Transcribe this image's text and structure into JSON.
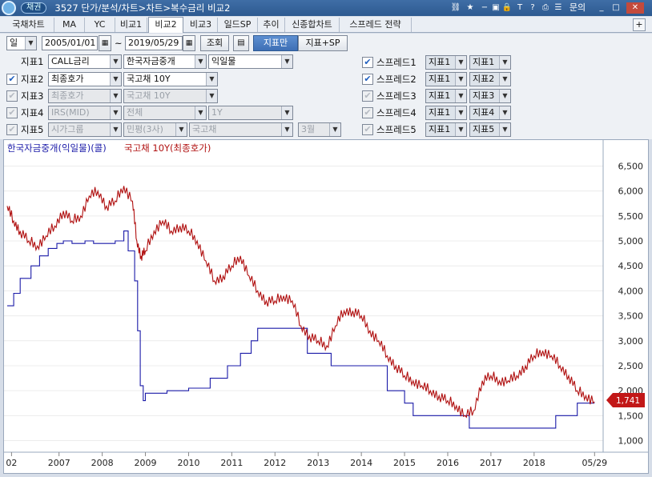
{
  "titlebar": {
    "badge": "채권",
    "title": "3527 단가/분석/차트>차트>복수금리 비교2",
    "menu_label": "문의"
  },
  "tabs": [
    "국채차트",
    "MA",
    "YC",
    "비교1",
    "비교2",
    "비교3",
    "일드SP",
    "추이",
    "신종합차트",
    "스프레드 전략"
  ],
  "active_tab": 4,
  "tab_plus": "+",
  "toolbar": {
    "period": "일",
    "start_date": "2005/01/01",
    "tilde": "~",
    "end_date": "2019/05/29",
    "query_label": "조회",
    "indicator_only_label": "지표만",
    "indicator_sp_label": "지표+SP"
  },
  "indicators": [
    {
      "label": "지표1",
      "checkbox": false,
      "enabled": true,
      "field1": "CALL금리",
      "field2": "한국자금중개",
      "field3": "익일물",
      "field4": ""
    },
    {
      "label": "지표2",
      "checkbox": true,
      "enabled": true,
      "field1": "최종호가",
      "field2": "국고채 10Y",
      "field3": "",
      "field4": ""
    },
    {
      "label": "지표3",
      "checkbox": true,
      "enabled": false,
      "field1": "최종호가",
      "field2": "국고채 10Y",
      "field3": "",
      "field4": ""
    },
    {
      "label": "지표4",
      "checkbox": true,
      "enabled": false,
      "field1": "IRS(MID)",
      "field2": "전체",
      "field3": "1Y",
      "field4": ""
    },
    {
      "label": "지표5",
      "checkbox": true,
      "enabled": false,
      "field1": "시가그룹",
      "field2": "민평(3사)",
      "field3": "국고채",
      "field4": "3월"
    }
  ],
  "spreads": [
    {
      "label": "스프레드1",
      "checked": true,
      "a": "지표1",
      "b": "지표1"
    },
    {
      "label": "스프레드2",
      "checked": true,
      "a": "지표1",
      "b": "지표2"
    },
    {
      "label": "스프레드3",
      "checked": false,
      "a": "지표1",
      "b": "지표3"
    },
    {
      "label": "스프레드4",
      "checked": false,
      "a": "지표1",
      "b": "지표4"
    },
    {
      "label": "스프레드5",
      "checked": false,
      "a": "지표1",
      "b": "지표5"
    }
  ],
  "chart_data": {
    "type": "line",
    "legend": [
      {
        "name": "한국자금중개(익일물)(콜)",
        "color": "#1a1aa8"
      },
      {
        "name": "국고채 10Y(최종호가)",
        "color": "#b01010"
      }
    ],
    "ylim": [
      800,
      6700
    ],
    "yticks": [
      "6,500",
      "6,000",
      "5,500",
      "5,000",
      "4,500",
      "4,000",
      "3,500",
      "3,000",
      "2,500",
      "2,000",
      "1,500",
      "1,000"
    ],
    "ytick_values": [
      6500,
      6000,
      5500,
      5000,
      4500,
      4000,
      3500,
      3000,
      2500,
      2000,
      1500,
      1000
    ],
    "xticks": [
      "02",
      "2007",
      "2008",
      "2009",
      "2010",
      "2011",
      "2012",
      "2013",
      "2014",
      "2015",
      "2016",
      "2017",
      "2018",
      "05/29"
    ],
    "xtick_years": [
      2005.9,
      2007,
      2008,
      2009,
      2010,
      2011,
      2012,
      2013,
      2014,
      2015,
      2016,
      2017,
      2018,
      2019.4
    ],
    "xlim": [
      2005.8,
      2019.45
    ],
    "last_value_label": "1,741",
    "series": [
      {
        "name": "한국자금중개(익일물)(콜)",
        "color": "#1a1aa8",
        "step": true,
        "x": [
          2005.8,
          2005.95,
          2006.1,
          2006.35,
          2006.55,
          2006.75,
          2006.95,
          2007.1,
          2007.3,
          2007.6,
          2007.8,
          2008.0,
          2008.3,
          2008.5,
          2008.6,
          2008.75,
          2008.82,
          2008.88,
          2008.95,
          2009.0,
          2009.5,
          2010.0,
          2010.5,
          2010.9,
          2011.2,
          2011.45,
          2011.6,
          2012.5,
          2012.75,
          2013.3,
          2013.8,
          2014.6,
          2015.0,
          2015.2,
          2015.55,
          2016.25,
          2016.5,
          2016.9,
          2017.0,
          2017.3,
          2017.9,
          2018.5,
          2018.9,
          2019.0,
          2019.4
        ],
        "y": [
          3700,
          3950,
          4250,
          4500,
          4700,
          4850,
          4950,
          5000,
          4950,
          5000,
          4950,
          4950,
          5000,
          5200,
          4800,
          4200,
          3200,
          2100,
          1800,
          1950,
          2000,
          2050,
          2250,
          2500,
          2750,
          3000,
          3250,
          3250,
          2750,
          2500,
          2500,
          2000,
          1750,
          1500,
          1500,
          1500,
          1250,
          1250,
          1250,
          1250,
          1250,
          1500,
          1500,
          1750,
          1750
        ]
      },
      {
        "name": "국고채 10Y(최종호가)",
        "color": "#b01010",
        "step": false,
        "x": [
          2005.8,
          2005.95,
          2006.1,
          2006.3,
          2006.5,
          2006.7,
          2006.9,
          2007.1,
          2007.3,
          2007.5,
          2007.7,
          2007.9,
          2008.1,
          2008.3,
          2008.5,
          2008.7,
          2008.8,
          2008.9,
          2009.0,
          2009.2,
          2009.4,
          2009.6,
          2009.8,
          2010.0,
          2010.2,
          2010.4,
          2010.6,
          2010.8,
          2011.0,
          2011.2,
          2011.4,
          2011.6,
          2011.8,
          2012.0,
          2012.2,
          2012.4,
          2012.6,
          2012.8,
          2013.0,
          2013.2,
          2013.4,
          2013.6,
          2013.8,
          2014.0,
          2014.2,
          2014.4,
          2014.6,
          2014.8,
          2015.0,
          2015.2,
          2015.4,
          2015.6,
          2015.8,
          2016.0,
          2016.2,
          2016.4,
          2016.6,
          2016.8,
          2017.0,
          2017.2,
          2017.4,
          2017.6,
          2017.8,
          2018.0,
          2018.2,
          2018.4,
          2018.6,
          2018.8,
          2019.0,
          2019.2,
          2019.4
        ],
        "y": [
          5700,
          5400,
          5200,
          5000,
          4900,
          5100,
          5300,
          5600,
          5400,
          5500,
          5900,
          6000,
          5700,
          5800,
          6100,
          5800,
          5000,
          4700,
          4800,
          5200,
          5400,
          5200,
          5300,
          5200,
          5000,
          4600,
          4200,
          4300,
          4500,
          4700,
          4300,
          4000,
          3800,
          3800,
          3900,
          3800,
          3300,
          3100,
          3000,
          2900,
          3300,
          3600,
          3600,
          3500,
          3200,
          3000,
          2700,
          2500,
          2300,
          2200,
          2100,
          2000,
          1900,
          1800,
          1700,
          1500,
          1600,
          2200,
          2300,
          2200,
          2200,
          2300,
          2500,
          2700,
          2800,
          2700,
          2500,
          2300,
          2000,
          1900,
          1780
        ]
      }
    ]
  }
}
